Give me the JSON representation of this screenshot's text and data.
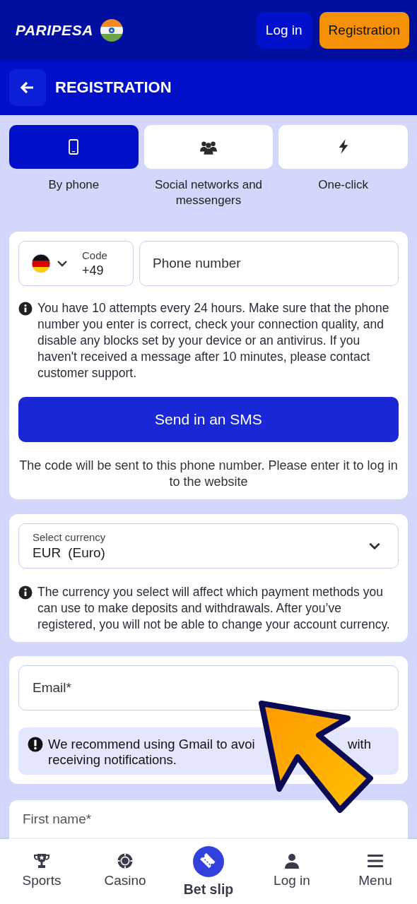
{
  "header": {
    "logo": "PARIPESA",
    "login_button": "Log in",
    "register_button": "Registration"
  },
  "page_title": {
    "title": "REGISTRATION"
  },
  "methods": [
    {
      "label": "By phone",
      "kind": "phone",
      "selected": true
    },
    {
      "label": "Social networks and messengers",
      "kind": "people",
      "selected": false
    },
    {
      "label": "One-click",
      "kind": "bolt",
      "selected": false
    }
  ],
  "phone_form": {
    "code_label": "Code",
    "code_value": "+49",
    "phone_placeholder": "Phone number",
    "info": "You have 10 attempts every 24 hours. Make sure that the phone number you enter is correct, check your connection quality, and disable any blocks set by your device or an antivirus. If you haven't received a message after 10 minutes, please contact customer support.",
    "send_button": "Send in an SMS",
    "note": "The code will be sent to this phone number. Please enter it to log in to the website"
  },
  "currency": {
    "label": "Select currency",
    "code": "EUR",
    "name": "(Euro)",
    "info": "The currency you select will affect which payment methods you can use to make deposits and withdrawals. After you’ve registered, you will not be able to change your account currency."
  },
  "email": {
    "placeholder": "Email*",
    "notice_parts": [
      "We recommend using Gmail to avoi",
      "with",
      "receiving notifications."
    ]
  },
  "first_name": {
    "placeholder": "First name*"
  },
  "bottom_nav": [
    {
      "label": "Sports",
      "kind": "trophy",
      "selected": false
    },
    {
      "label": "Casino",
      "kind": "chip",
      "selected": false
    },
    {
      "label": "Bet slip",
      "kind": "ticket",
      "selected": true
    },
    {
      "label": "Log in",
      "kind": "user",
      "selected": false
    },
    {
      "label": "Menu",
      "kind": "menu",
      "selected": false
    }
  ]
}
